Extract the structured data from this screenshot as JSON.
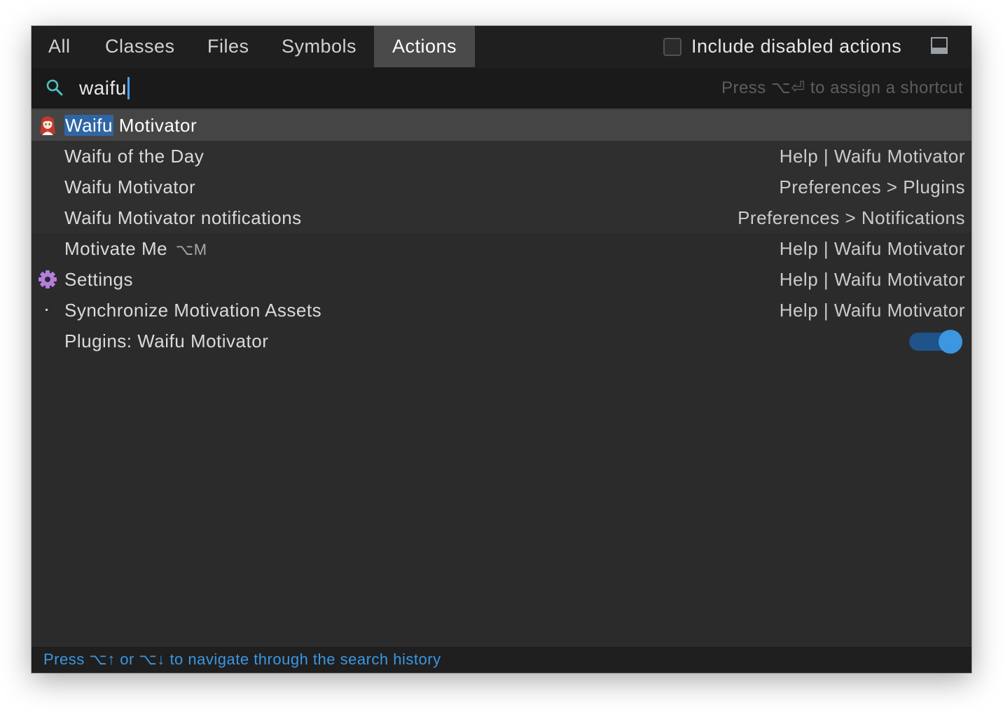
{
  "tabs": [
    {
      "label": "All"
    },
    {
      "label": "Classes"
    },
    {
      "label": "Files"
    },
    {
      "label": "Symbols"
    },
    {
      "label": "Actions",
      "active": true
    }
  ],
  "include_disabled": {
    "label": "Include disabled actions",
    "checked": false
  },
  "search": {
    "value": "waifu",
    "hint": "Press ⌥⏎ to assign a shortcut"
  },
  "results": [
    {
      "highlight": "Waifu",
      "rest": " Motivator",
      "location": "",
      "icon": "waifu-avatar-icon"
    },
    {
      "name": "Waifu of the Day",
      "location": "Help | Waifu Motivator"
    },
    {
      "name": "Waifu Motivator",
      "location": "Preferences > Plugins"
    },
    {
      "name": "Waifu Motivator notifications",
      "location": "Preferences > Notifications"
    },
    {
      "name": "Motivate Me",
      "shortcut": "⌥M",
      "location": "Help | Waifu Motivator"
    },
    {
      "name": "Settings",
      "location": "Help | Waifu Motivator",
      "icon": "gear-icon"
    },
    {
      "name": "Synchronize Motivation Assets",
      "location": "Help | Waifu Motivator"
    },
    {
      "name": "Plugins: Waifu Motivator",
      "location": "",
      "toggle_on": true
    }
  ],
  "footer": {
    "text": "Press ⌥↑ or ⌥↓ to navigate through the search history"
  },
  "colors": {
    "accent": "#3b97e3",
    "selection_highlight": "#2f65a5",
    "gear": "#b57edc"
  }
}
